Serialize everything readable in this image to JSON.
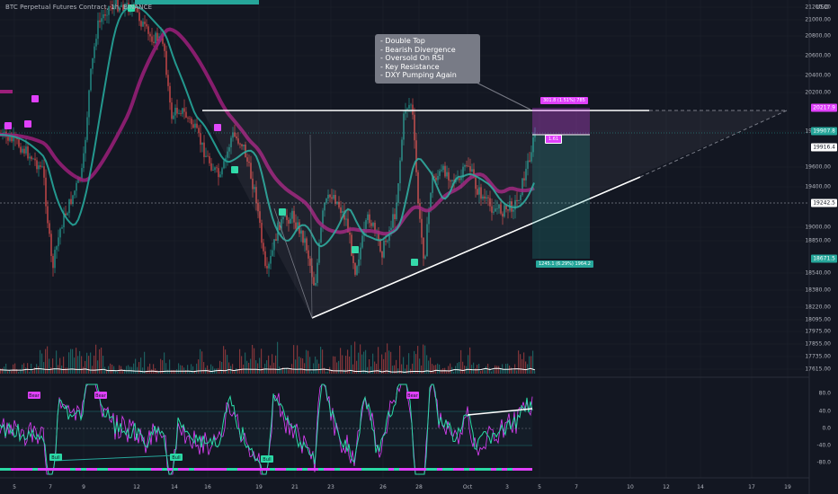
{
  "header": {
    "symbol_line": "BTC Perpetual Futures Contract, 1h, BINANCE",
    "currency": "USD"
  },
  "price_axis": {
    "ticks": [
      "21200.00",
      "21000.00",
      "20800.00",
      "20600.00",
      "20400.00",
      "20200.00",
      "19800.00",
      "19600.00",
      "19400.00",
      "19000.00",
      "18850.00",
      "18540.00",
      "18380.00",
      "18220.00",
      "18095.00",
      "17975.00",
      "17855.00",
      "17735.00",
      "17615.00"
    ],
    "tags": [
      {
        "label": "20217.9",
        "color": "#e040fb",
        "text_color": "#ffffff"
      },
      {
        "label": "19907.8",
        "color": "#26a69a",
        "text_color": "#ffffff"
      },
      {
        "label": "19916.4",
        "color": "#ffffff",
        "text_color": "#131722"
      },
      {
        "label": "19242.5",
        "color": "#ffffff",
        "text_color": "#131722"
      },
      {
        "label": "18671.5",
        "color": "#26a69a",
        "text_color": "#ffffff"
      }
    ]
  },
  "oscillator_axis": {
    "ticks": [
      "80.0",
      "40.0",
      "0.0",
      "-40.0",
      "-80.0"
    ]
  },
  "date_axis": {
    "ticks": [
      "5",
      "7",
      "9",
      "12",
      "14",
      "16",
      "19",
      "21",
      "23",
      "26",
      "28",
      "Oct",
      "3",
      "5",
      "7",
      "10",
      "12",
      "14",
      "17",
      "19"
    ]
  },
  "annotation": {
    "lines": [
      "- Double Top",
      "- Bearish Divergence",
      "- Oversold On RSI",
      "- Key Resistance",
      "- DXY Pumping Again"
    ]
  },
  "position_tool": {
    "target_label": "301.8 (1.51%) 785",
    "entry_label": "1.61",
    "stop_label": "1245.1 (6.29%) 1964.2"
  },
  "rsi_labels": [
    "Bull",
    "Bull",
    "Bull",
    "Bear",
    "Bear",
    "Bear"
  ],
  "colors": {
    "background": "#131722",
    "up": "#26a69a",
    "down": "#ef5350",
    "magenta": "#e040fb",
    "pink_ma": "#9c1f7a",
    "teal": "#2bd9a6",
    "white": "#ffffff"
  },
  "chart_data": {
    "type": "line",
    "title": "BTC Perpetual Futures Contract, 1h, BINANCE",
    "xlabel": "",
    "ylabel": "USD",
    "categories": [
      "5",
      "7",
      "9",
      "12",
      "14",
      "16",
      "19",
      "21",
      "23",
      "26",
      "28",
      "Oct",
      "3",
      "5"
    ],
    "series": [
      {
        "values": [
          19800,
          19500,
          20400,
          21200,
          20300,
          19900,
          19250,
          18750,
          19100,
          19300,
          19400,
          19350,
          19250,
          19900
        ]
      }
    ],
    "ylim": [
      17615,
      21300
    ],
    "grid": true
  }
}
